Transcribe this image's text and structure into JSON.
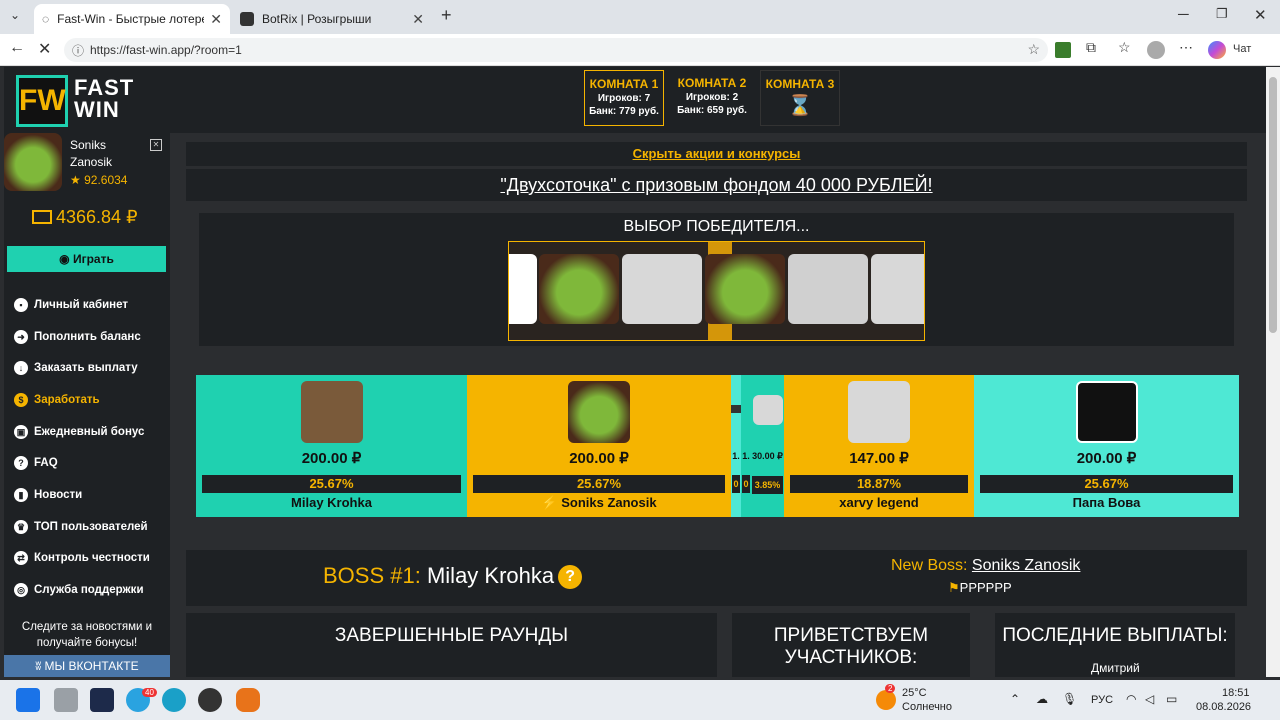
{
  "browser": {
    "tabs": [
      {
        "title": "Fast-Win - Быстрые лотереи! Ком"
      },
      {
        "title": "BotRix | Розыгрыши"
      }
    ],
    "url": "https://fast-win.app/?room=1",
    "chat_label": "Чат"
  },
  "site": {
    "logo": {
      "mark": "FW",
      "line1": "FAST",
      "line2": "WIN"
    },
    "rooms": [
      {
        "title": "КОМНАТА 1",
        "players": "Игроков: 7",
        "bank": "Банк: 779 руб."
      },
      {
        "title": "КОМНАТА 2",
        "players": "Игроков: 2",
        "bank": "Банк: 659 руб."
      },
      {
        "title": "КОМНАТА 3",
        "players": "",
        "bank": ""
      }
    ],
    "user": {
      "name": "Soniks Zanosik",
      "rating": "★ 92.6034",
      "balance": "4366.84 ₽"
    },
    "play_button": "Играть",
    "menu": [
      "Личный кабинет",
      "Пополнить баланс",
      "Заказать выплату",
      "Заработать",
      "Ежедневный бонус",
      "FAQ",
      "Новости",
      "ТОП пользователей",
      "Контроль честности",
      "Служба поддержки"
    ],
    "follow_text": "Следите за новостями и получайте бонусы!",
    "vk_button": "МЫ ВКОНТАКТЕ",
    "hide_promos": "Скрыть акции и конкурсы",
    "promo": "\"Двухсоточка\" с призовым фондом 40 000 РУБЛЕЙ!",
    "picker_title": "ВЫБОР ПОБЕДИТЕЛЯ...",
    "participants": [
      {
        "amount": "200.00 ₽",
        "percent": "25.67%",
        "name": "Milay Krohka",
        "color": "#1fd1b0"
      },
      {
        "amount": "200.00 ₽",
        "percent": "25.67%",
        "name": "⚡ Soniks Zanosik",
        "color": "#f5b400"
      },
      {
        "amount": "1.",
        "percent": "0",
        "name": "",
        "color": "#4ee8d4"
      },
      {
        "amount": "1.",
        "percent": "0",
        "name": "",
        "color": "#1fd1b0"
      },
      {
        "amount": "30.00 ₽",
        "percent": "3.85%",
        "name": "",
        "color": "#1fd1b0"
      },
      {
        "amount": "147.00 ₽",
        "percent": "18.87%",
        "name": "xarvy legend",
        "color": "#f5b400"
      },
      {
        "amount": "200.00 ₽",
        "percent": "25.67%",
        "name": "Папа Вова",
        "color": "#4ee8d4"
      }
    ],
    "boss_label": "BOSS #1:",
    "boss_name": "Milay Krohka",
    "new_boss_label": "New Boss:",
    "new_boss_name": "Soniks Zanosik",
    "flags": "РРРРРР",
    "panels": [
      "ЗАВЕРШЕННЫЕ РАУНДЫ",
      "ПРИВЕТСТВУЕМ УЧАСТНИКОВ:",
      "ПОСЛЕДНИЕ ВЫПЛАТЫ:"
    ],
    "payout_name": "Дмитрий"
  },
  "taskbar": {
    "weather_temp": "25°C",
    "weather_text": "Солнечно",
    "lang": "РУС",
    "time": "18:51",
    "date": "08.08.2026",
    "badge_mail": "40",
    "badge_weather": "2"
  }
}
